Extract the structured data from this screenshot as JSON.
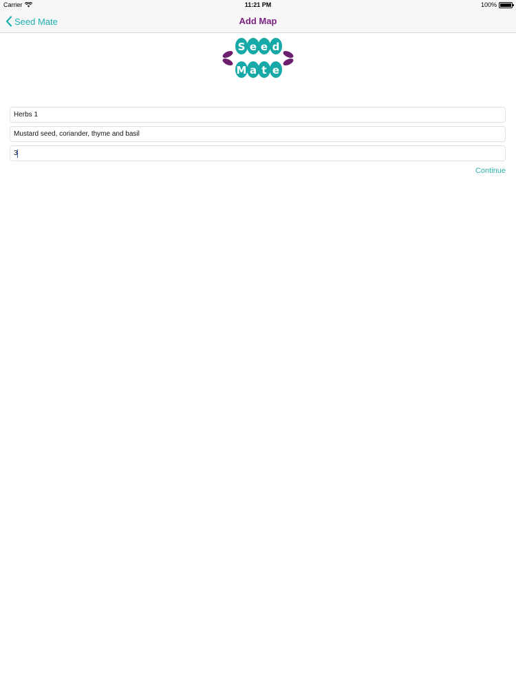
{
  "status_bar": {
    "carrier": "Carrier",
    "time": "11:21 PM",
    "battery": "100%"
  },
  "nav": {
    "back_label": "Seed Mate",
    "title": "Add Map"
  },
  "logo": {
    "line1": [
      "S",
      "e",
      "e",
      "d"
    ],
    "line2": [
      "M",
      "a",
      "t",
      "e"
    ]
  },
  "form": {
    "name": "Herbs 1",
    "description": "Mustard seed, coriander, thyme and basil",
    "count": "3",
    "continue_label": "Continue"
  },
  "colors": {
    "accent": "#1ab0b0",
    "title": "#7b1f80",
    "logo_teal": "#17a9a7",
    "logo_purple": "#6b1f6e"
  }
}
